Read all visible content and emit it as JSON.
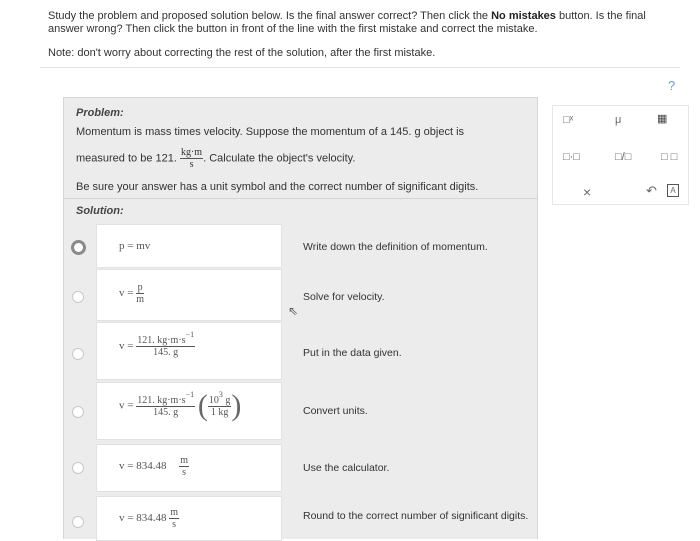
{
  "instructions": {
    "part1": "Study the problem and proposed solution below. Is the final answer correct? Then click the ",
    "bold": "No mistakes",
    "part2": " button. Is the final answer wrong? Then click the button in front of the line with the first mistake and correct the mistake.",
    "note": "Note: don't worry about correcting the rest of the solution, after the first mistake."
  },
  "help_label": "?",
  "problem": {
    "title": "Problem:",
    "line1": "Momentum is mass times velocity. Suppose the momentum of a 145. g object is",
    "line2_prefix": "measured to be 121.",
    "unit_num": "kg·m",
    "unit_den": "s",
    "line2_suffix": ". Calculate the object's velocity.",
    "line3": "Be sure your answer has a unit symbol and the correct number of significant digits.",
    "solution_title": "Solution:"
  },
  "steps": [
    {
      "comment": "Write down the definition of momentum.",
      "selected": true
    },
    {
      "comment": "Solve for velocity.",
      "selected": false
    },
    {
      "comment": "Put in the data given.",
      "selected": false
    },
    {
      "comment": "Convert units.",
      "selected": false
    },
    {
      "comment": "Use the calculator.",
      "selected": false
    },
    {
      "comment": "Round to the correct number of significant digits.",
      "selected": false
    }
  ],
  "equations": {
    "eq1": "p = mv",
    "v": "v",
    "eq": "=",
    "p": "p",
    "m": "m",
    "data_num": "121. kg·m·s",
    "data_den": "145. g",
    "neg1": "−1",
    "ten3_base": "10",
    "three": "3",
    "g": "g",
    "kg1": "1 kg",
    "calc_value": "834.48",
    "round_value": "834.48",
    "unit_m": "m",
    "unit_s": "s"
  },
  "tools": {
    "superscript": "□ˣ",
    "mu": "μ",
    "keyboard": "▦",
    "times": "□·□",
    "fraction": "□/□",
    "units": "□ □",
    "clear": "×",
    "undo": "↶",
    "text": "A"
  }
}
